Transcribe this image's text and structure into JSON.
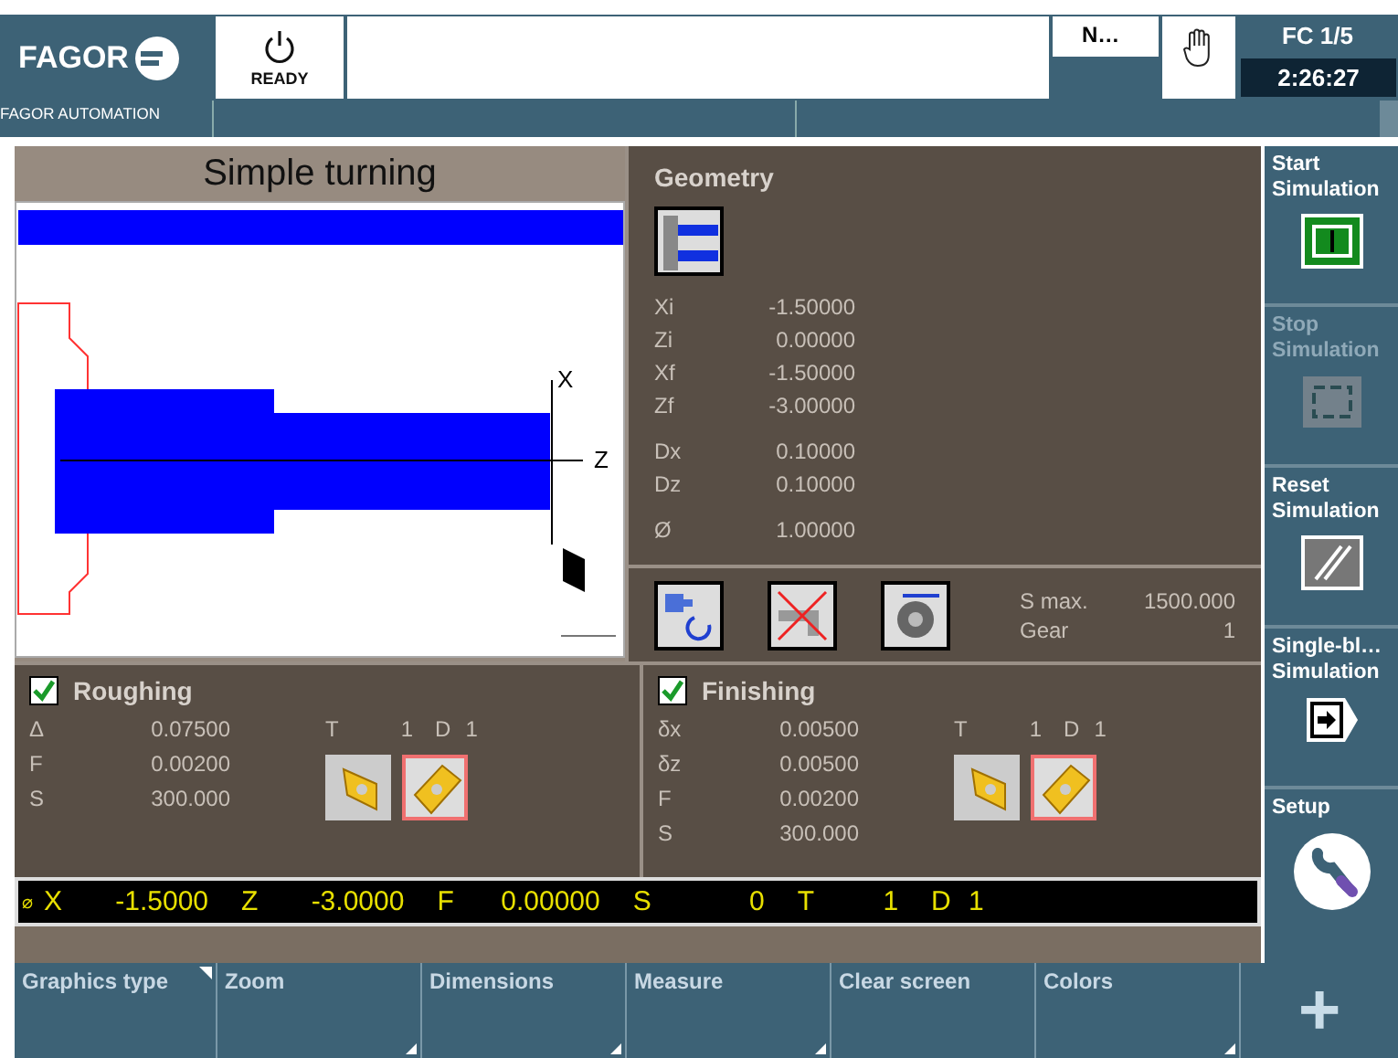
{
  "header": {
    "brand": "FAGOR",
    "subtitle": "FAGOR AUTOMATION",
    "status": "READY",
    "mode": "N…",
    "program": "FC 1/5",
    "time": "2:26:27"
  },
  "graphics": {
    "title": "Simple turning",
    "axis_x": "X",
    "axis_z": "Z"
  },
  "geometry": {
    "title": "Geometry",
    "groups": [
      [
        {
          "label": "Xi",
          "value": "-1.50000"
        },
        {
          "label": "Zi",
          "value": "0.00000"
        },
        {
          "label": "Xf",
          "value": "-1.50000"
        },
        {
          "label": "Zf",
          "value": "-3.00000"
        }
      ],
      [
        {
          "label": "Dx",
          "value": "0.10000"
        },
        {
          "label": "Dz",
          "value": "0.10000"
        }
      ],
      [
        {
          "label": "Ø",
          "value": "1.00000"
        }
      ]
    ],
    "settings": [
      {
        "label": "S max.",
        "value": "1500.000"
      },
      {
        "label": "Gear",
        "value": "1"
      }
    ]
  },
  "operations": [
    {
      "label": "Roughing",
      "checked": true,
      "params": [
        {
          "label": "Δ",
          "value": "0.07500"
        },
        {
          "label": "F",
          "value": "0.00200"
        },
        {
          "label": "S",
          "value": "300.000"
        }
      ],
      "tool": [
        {
          "label": "T",
          "value": "1"
        },
        {
          "label": "D",
          "value": "1"
        }
      ],
      "inserts": [
        {
          "selected": false
        },
        {
          "selected": true
        }
      ]
    },
    {
      "label": "Finishing",
      "checked": true,
      "params": [
        {
          "label": "δx",
          "value": "0.00500"
        },
        {
          "label": "δz",
          "value": "0.00500"
        },
        {
          "label": "F",
          "value": "0.00200"
        },
        {
          "label": "S",
          "value": "300.000"
        }
      ],
      "tool": [
        {
          "label": "T",
          "value": "1"
        },
        {
          "label": "D",
          "value": "1"
        }
      ],
      "inserts": [
        {
          "selected": false
        },
        {
          "selected": true
        }
      ]
    }
  ],
  "position": {
    "prefix": "⌀",
    "items": [
      {
        "label": "X",
        "value": "-1.5000"
      },
      {
        "label": "Z",
        "value": "-3.0000"
      },
      {
        "label": "F",
        "value": "0.00000"
      },
      {
        "label": "S",
        "value": "0"
      },
      {
        "label": "T",
        "value": "1"
      },
      {
        "label": "D",
        "value": "1"
      }
    ]
  },
  "sidebar": [
    {
      "lines": [
        "Start",
        "Simulation"
      ],
      "kind": "start",
      "disabled": false
    },
    {
      "lines": [
        "Stop",
        "Simulation"
      ],
      "kind": "stop",
      "disabled": true
    },
    {
      "lines": [
        "Reset",
        "Simulation"
      ],
      "kind": "reset",
      "disabled": false
    },
    {
      "lines": [
        "Single-bl…",
        "Simulation"
      ],
      "kind": "single",
      "disabled": false
    },
    {
      "lines": [
        "Setup"
      ],
      "kind": "setup",
      "disabled": false
    }
  ],
  "softkeys": [
    {
      "label": "Graphics type",
      "kind": "top-mark"
    },
    {
      "label": "Zoom",
      "kind": "submenu"
    },
    {
      "label": "Dimensions",
      "kind": "submenu"
    },
    {
      "label": "Measure",
      "kind": "submenu"
    },
    {
      "label": "Clear screen",
      "kind": "plain"
    },
    {
      "label": "Colors",
      "kind": "submenu"
    },
    {
      "label": "+",
      "kind": "more"
    }
  ]
}
